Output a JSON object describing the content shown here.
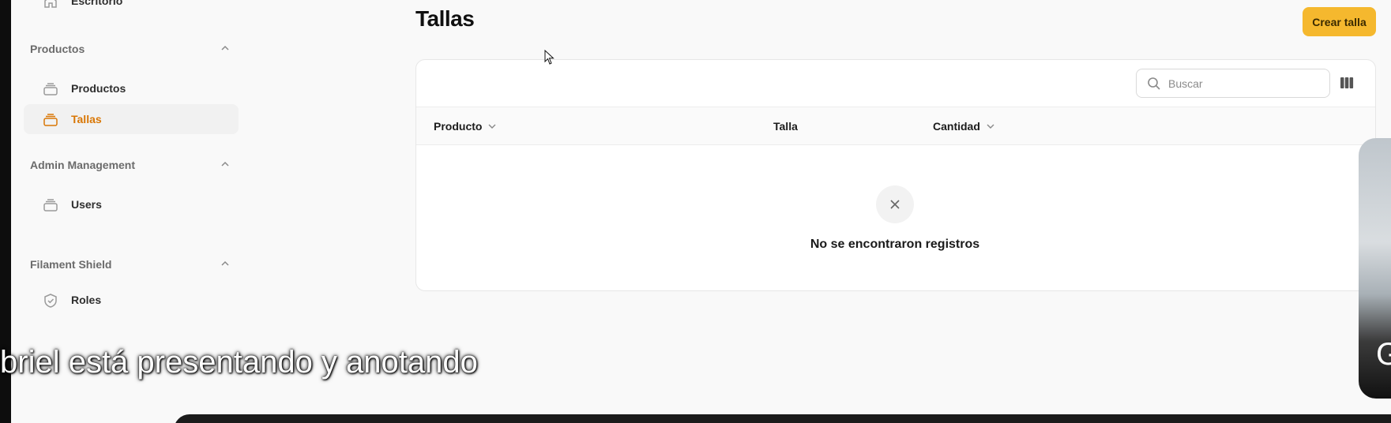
{
  "sidebar": {
    "top_item": {
      "label": "Escritorio",
      "icon": "home-icon"
    },
    "groups": [
      {
        "label": "Productos",
        "collapse_icon": "chevron-up-icon",
        "items": [
          {
            "label": "Productos",
            "icon": "rectangle-stack-icon",
            "active": false
          },
          {
            "label": "Tallas",
            "icon": "rectangle-stack-icon",
            "active": true
          }
        ]
      },
      {
        "label": "Admin Management",
        "collapse_icon": "chevron-up-icon",
        "items": [
          {
            "label": "Users",
            "icon": "rectangle-stack-icon",
            "active": false
          }
        ]
      },
      {
        "label": "Filament Shield",
        "collapse_icon": "chevron-up-icon",
        "items": [
          {
            "label": "Roles",
            "icon": "shield-check-icon",
            "active": false
          }
        ]
      }
    ]
  },
  "header": {
    "title": "Tallas",
    "create_button": "Crear talla"
  },
  "table": {
    "search": {
      "placeholder": "Buscar",
      "value": ""
    },
    "columns": [
      {
        "label": "Producto",
        "sortable": true
      },
      {
        "label": "Talla",
        "sortable": false
      },
      {
        "label": "Cantidad",
        "sortable": true
      }
    ],
    "empty_state": {
      "icon": "x-mark-icon",
      "text": "No se encontraron registros"
    }
  },
  "overlay": {
    "caption": "briel está presentando y anotando",
    "video_tile_text": "G"
  },
  "colors": {
    "accent": "#f5b82e",
    "active_nav_text": "#d97706",
    "page_background": "#f9f9f9"
  }
}
